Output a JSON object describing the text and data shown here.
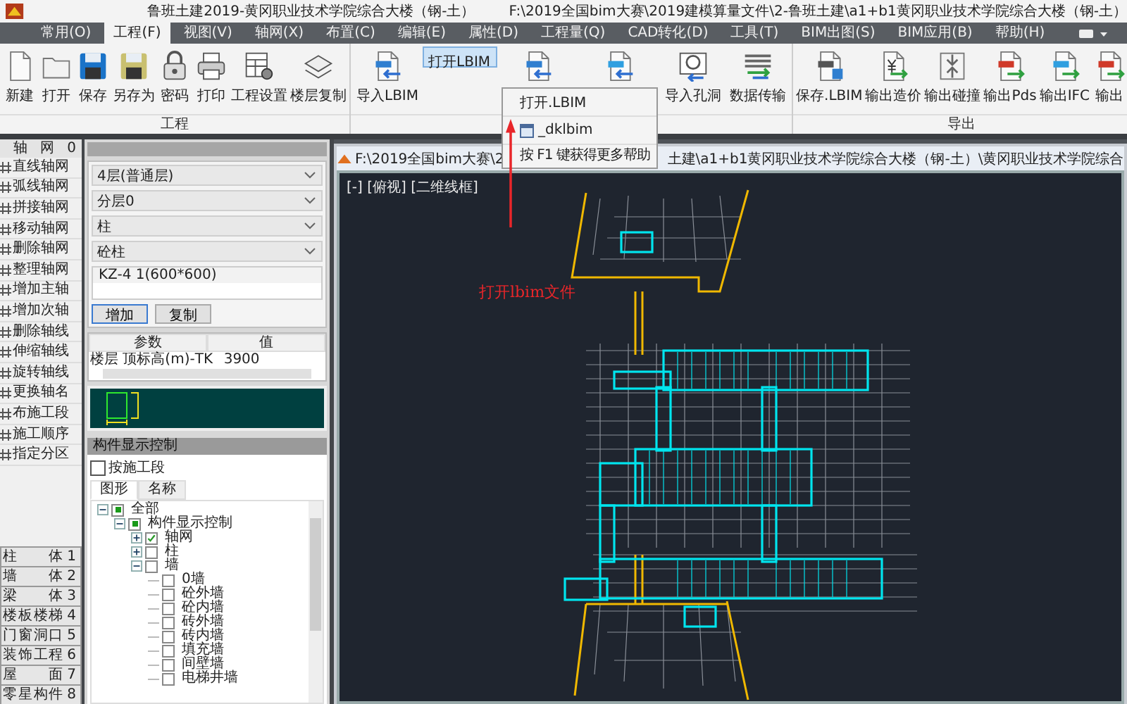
{
  "window": {
    "title": "鲁班土建2019-黄冈职业技术学院综合大楼（钢-土）",
    "path": "F:\\2019全国bim大赛\\2019建模算量文件\\2-鲁班土建\\a1+b1黄冈职业技术学院综合大楼（钢-土）"
  },
  "menu": [
    {
      "label": "常用(O)",
      "selected": false
    },
    {
      "label": "工程(F)",
      "selected": true
    },
    {
      "label": "视图(V)",
      "selected": false
    },
    {
      "label": "轴网(X)",
      "selected": false
    },
    {
      "label": "布置(C)",
      "selected": false
    },
    {
      "label": "编辑(E)",
      "selected": false
    },
    {
      "label": "属性(D)",
      "selected": false
    },
    {
      "label": "工程量(Q)",
      "selected": false
    },
    {
      "label": "CAD转化(D)",
      "selected": false
    },
    {
      "label": "工具(T)",
      "selected": false
    },
    {
      "label": "BIM出图(S)",
      "selected": false
    },
    {
      "label": "BIM应用(B)",
      "selected": false
    },
    {
      "label": "帮助(H)",
      "selected": false
    }
  ],
  "ribbon": [
    {
      "label": "工程",
      "buttons": [
        {
          "kind": "new",
          "label": "新建",
          "selected": false
        },
        {
          "kind": "open",
          "label": "打开",
          "selected": false
        },
        {
          "kind": "save",
          "label": "保存",
          "selected": false
        },
        {
          "kind": "saveas",
          "label": "另存为",
          "selected": false
        },
        {
          "kind": "password",
          "label": "密码",
          "selected": false
        },
        {
          "kind": "print",
          "label": "打印",
          "selected": false
        },
        {
          "kind": "settings",
          "label": "工程设置",
          "selected": false
        },
        {
          "kind": "copyfloor",
          "label": "楼层复制",
          "selected": false
        }
      ]
    },
    {
      "buttons": [
        {
          "kind": "importlbim",
          "label": "导入LBIM",
          "selected": false
        },
        {
          "kind": "openlbim",
          "label": "打开LBIM",
          "selected": true
        },
        {
          "kind": "importpds",
          "selected": false
        },
        {
          "kind": "importifc",
          "selected": false
        },
        {
          "kind": "importhole",
          "label": "导入孔洞",
          "selected": false
        },
        {
          "kind": "transfer",
          "label": "数据传输",
          "selected": false
        }
      ]
    },
    {
      "label": "导出",
      "buttons": [
        {
          "kind": "savelbim",
          "label": "保存.LBIM",
          "selected": false
        },
        {
          "kind": "exportcost",
          "label": "输出造价",
          "selected": false
        },
        {
          "kind": "exportclash",
          "label": "输出碰撞",
          "selected": false
        },
        {
          "kind": "exportpds",
          "label": "输出Pds",
          "selected": false
        },
        {
          "kind": "exportifc",
          "label": "输出IFC",
          "selected": false
        },
        {
          "kind": "exportdrf",
          "label": "输出",
          "selected": false
        }
      ]
    }
  ],
  "dropdown": {
    "items": [
      {
        "label": "打开.LBIM",
        "icon": false
      },
      {
        "label": "_dklbim",
        "icon": true
      }
    ],
    "hint": "按 F1 键获得更多帮助"
  },
  "annotation": "打开lbim文件",
  "axis_toolbar": {
    "header": "轴 网 0",
    "items": [
      "直线轴网",
      "弧线轴网",
      "拼接轴网",
      "移动轴网",
      "删除轴网",
      "整理轴网",
      "增加主轴",
      "增加次轴",
      "删除轴线",
      "伸缩轴线",
      "旋转轴线",
      "更换轴名",
      "布施工段",
      "施工顺序",
      "指定分区"
    ],
    "categories": [
      {
        "label": "柱 体",
        "number": "1"
      },
      {
        "label": "墙 体",
        "number": "2"
      },
      {
        "label": "梁 体",
        "number": "3"
      },
      {
        "label": "楼板楼梯",
        "number": "4"
      },
      {
        "label": "门窗洞口",
        "number": "5"
      },
      {
        "label": "装饰工程",
        "number": "6"
      },
      {
        "label": "屋 面",
        "number": "7"
      },
      {
        "label": "零星构件",
        "number": "8"
      }
    ]
  },
  "properties": {
    "selects": [
      "4层(普通层)",
      "分层0",
      "柱",
      "砼柱"
    ],
    "components": [
      "KZ-4 1(600*600)"
    ],
    "buttons": [
      "增加",
      "复制"
    ],
    "table": {
      "columns": [
        "参数",
        "值"
      ],
      "rows": [
        [
          "楼层 顶标高(m)-TK",
          "3900"
        ]
      ]
    }
  },
  "display_control": {
    "title": "构件显示控制",
    "by_stage": {
      "label": "按施工段",
      "checked": false
    },
    "tabs": [
      {
        "label": "图形",
        "selected": true
      },
      {
        "label": "名称",
        "selected": false
      }
    ],
    "tree": [
      {
        "label": "全部",
        "checked": false,
        "partial": true,
        "expanded": true,
        "children": [
          {
            "label": "构件显示控制",
            "checked": false,
            "partial": true,
            "expanded": true,
            "children": [
              {
                "label": "轴网",
                "checked": true,
                "partial": false,
                "expanded": false
              },
              {
                "label": "柱",
                "checked": false,
                "partial": false,
                "expanded": false
              },
              {
                "label": "墙",
                "checked": false,
                "partial": false,
                "expanded": true,
                "children": [
                  {
                    "label": "0墙",
                    "checked": false,
                    "partial": false
                  },
                  {
                    "label": "砼外墙",
                    "checked": false,
                    "partial": false
                  },
                  {
                    "label": "砼内墙",
                    "checked": false,
                    "partial": false
                  },
                  {
                    "label": "砖外墙",
                    "checked": false,
                    "partial": false
                  },
                  {
                    "label": "砖内墙",
                    "checked": false,
                    "partial": false
                  },
                  {
                    "label": "填充墙",
                    "checked": false,
                    "partial": false
                  },
                  {
                    "label": "间壁墙",
                    "checked": false,
                    "partial": false
                  },
                  {
                    "label": "电梯井墙",
                    "checked": false,
                    "partial": false
                  }
                ]
              }
            ]
          }
        ]
      }
    ]
  },
  "drawing_window": {
    "title_start": "F:\\2019全国bim大赛\\2",
    "title_end": "土建\\a1+b1黄冈职业技术学院综合大楼（钢-土）\\黄冈职业技术学院综合",
    "view_label": "[-] [俯视] [二维线框]"
  }
}
